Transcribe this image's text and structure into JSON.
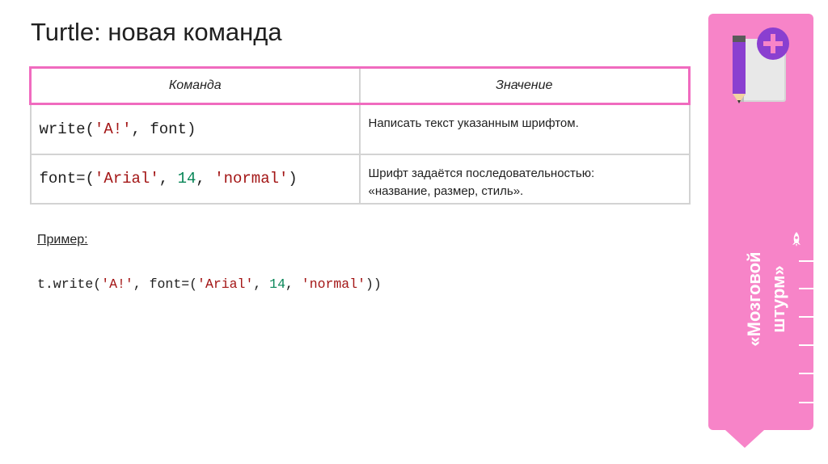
{
  "slide": {
    "title": "Turtle: новая команда"
  },
  "table": {
    "headers": [
      "Команда",
      "Значение"
    ],
    "rows": [
      {
        "code_parts": [
          {
            "t": "write(",
            "c": "plain"
          },
          {
            "t": "'A!'",
            "c": "str"
          },
          {
            "t": ", font)",
            "c": "plain"
          }
        ],
        "description": "Написать текст указанным шрифтом."
      },
      {
        "code_parts": [
          {
            "t": "font=(",
            "c": "plain"
          },
          {
            "t": "'Arial'",
            "c": "str"
          },
          {
            "t": ", ",
            "c": "plain"
          },
          {
            "t": "14",
            "c": "num"
          },
          {
            "t": ", ",
            "c": "plain"
          },
          {
            "t": "'normal'",
            "c": "str"
          },
          {
            "t": ")",
            "c": "plain"
          }
        ],
        "description": "Шрифт задаётся последовательностью: «название, размер, стиль»."
      }
    ]
  },
  "example": {
    "label": "Пример:",
    "code_parts": [
      {
        "t": "t.write(",
        "c": "plain"
      },
      {
        "t": "'A!'",
        "c": "str"
      },
      {
        "t": ", font=(",
        "c": "plain"
      },
      {
        "t": "'Arial'",
        "c": "str"
      },
      {
        "t": ", ",
        "c": "plain"
      },
      {
        "t": "14",
        "c": "num"
      },
      {
        "t": ", ",
        "c": "plain"
      },
      {
        "t": "'normal'",
        "c": "str"
      },
      {
        "t": "))",
        "c": "plain"
      }
    ]
  },
  "banner": {
    "line1": "«Мозговой",
    "line2": "штурм»",
    "icons": [
      "notebook-pencil-plus-icon",
      "rocket-icon"
    ]
  },
  "colors": {
    "accent_pink": "#f784c8",
    "table_border_pink": "#f06bbf",
    "code_string": "#a31515",
    "code_number": "#098658"
  }
}
